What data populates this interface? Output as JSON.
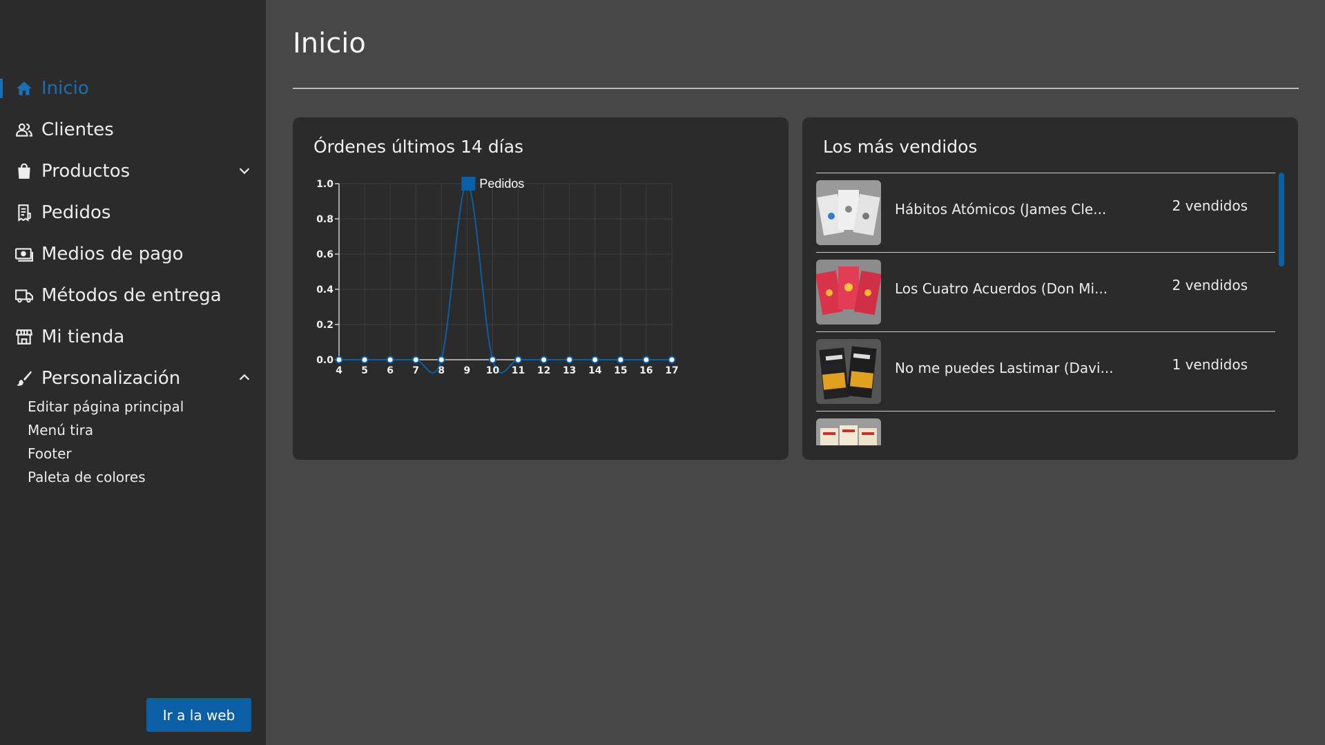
{
  "sidebar": {
    "items": [
      {
        "label": "Inicio",
        "icon": "home-icon"
      },
      {
        "label": "Clientes",
        "icon": "users-icon"
      },
      {
        "label": "Productos",
        "icon": "shopping-bag-icon"
      },
      {
        "label": "Pedidos",
        "icon": "receipt-icon"
      },
      {
        "label": "Medios de pago",
        "icon": "money-icon"
      },
      {
        "label": "Métodos de entrega",
        "icon": "truck-icon"
      },
      {
        "label": "Mi tienda",
        "icon": "store-icon"
      },
      {
        "label": "Personalización",
        "icon": "brush-icon"
      }
    ],
    "subitems": [
      "Editar página principal",
      "Menú tira",
      "Footer",
      "Paleta de colores"
    ],
    "web_button": "Ir a la web",
    "accent_color": "#1c6fb4"
  },
  "main": {
    "title": "Inicio",
    "orders_card": {
      "title": "Órdenes últimos 14 días"
    },
    "bestsellers": {
      "title": "Los más vendidos",
      "items": [
        {
          "name": "Hábitos Atómicos (James Cle...",
          "sold": "2 vendidos"
        },
        {
          "name": "Los Cuatro Acuerdos (Don Mi...",
          "sold": "2 vendidos"
        },
        {
          "name": "No me puedes Lastimar (Davi...",
          "sold": "1 vendidos"
        }
      ]
    }
  },
  "chart_data": {
    "type": "line",
    "title": "",
    "xlabel": "",
    "ylabel": "",
    "x": [
      "4",
      "5",
      "6",
      "7",
      "8",
      "9",
      "10",
      "11",
      "12",
      "13",
      "14",
      "15",
      "16",
      "17"
    ],
    "series": [
      {
        "name": "Pedidos",
        "values": [
          0,
          0,
          0,
          0,
          0,
          1,
          0,
          0,
          0,
          0,
          0,
          0,
          0,
          0
        ]
      }
    ],
    "ylim": [
      0,
      1
    ],
    "yticks": [
      "0.0",
      "0.2",
      "0.4",
      "0.6",
      "0.8",
      "1.0"
    ],
    "grid": true,
    "legend": "top-center",
    "color": "#0a5fa5"
  }
}
